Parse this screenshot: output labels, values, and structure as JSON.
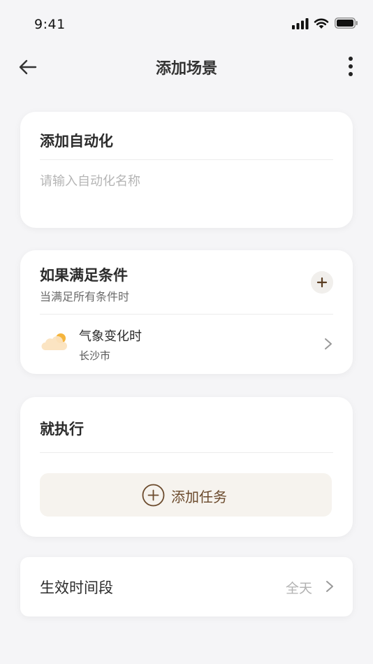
{
  "status_bar": {
    "time": "9:41",
    "icons": [
      "signal-icon",
      "wifi-icon",
      "battery-icon"
    ]
  },
  "header": {
    "title": "添加场景",
    "back_icon": "arrow-left-icon",
    "more_icon": "more-vertical-icon"
  },
  "automation_name": {
    "title": "添加自动化",
    "value": "",
    "placeholder": "请输入自动化名称"
  },
  "conditions": {
    "title": "如果满足条件",
    "subtitle": "当满足所有条件时",
    "add_icon": "plus-icon",
    "items": [
      {
        "label": "气象变化时",
        "detail": "长沙市",
        "icon": "weather-icon"
      }
    ]
  },
  "execute": {
    "title": "就执行",
    "add_task_label": "添加任务",
    "add_icon": "plus-circle-icon"
  },
  "effective_period": {
    "label": "生效时间段",
    "value": "全天"
  },
  "colors": {
    "background": "#f5f5f7",
    "card": "#ffffff",
    "accent_brown": "#6b4a2c",
    "task_button_bg": "#f6f3ee",
    "muted_text": "#b2b2b2"
  }
}
